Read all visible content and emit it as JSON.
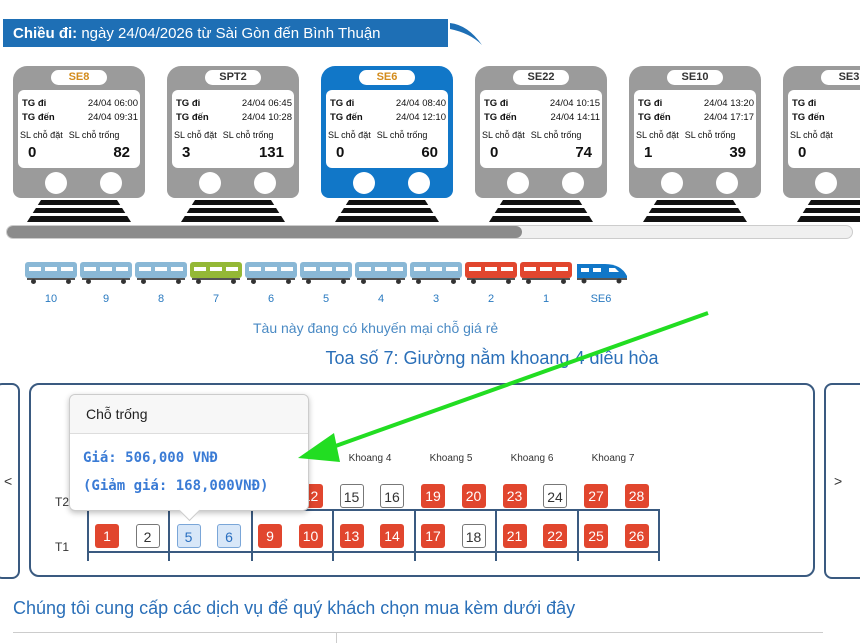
{
  "header": {
    "label": "Chiều đi:",
    "text": "ngày 24/04/2026 từ Sài Gòn đến Bình Thuận"
  },
  "trains": [
    {
      "code": "SE8",
      "code_color": "gold",
      "active": false,
      "tg_di_label": "TG đi",
      "tg_di": "24/04 06:00",
      "tg_den_label": "TG đến",
      "tg_den": "24/04 09:31",
      "booked_label": "SL chỗ đặt",
      "free_label": "SL chỗ trống",
      "booked": "0",
      "free": "82"
    },
    {
      "code": "SPT2",
      "code_color": "dark",
      "active": false,
      "tg_di_label": "TG đi",
      "tg_di": "24/04 06:45",
      "tg_den_label": "TG đến",
      "tg_den": "24/04 10:28",
      "booked_label": "SL chỗ đặt",
      "free_label": "SL chỗ trống",
      "booked": "3",
      "free": "131"
    },
    {
      "code": "SE6",
      "code_color": "gold",
      "active": true,
      "tg_di_label": "TG đi",
      "tg_di": "24/04 08:40",
      "tg_den_label": "TG đến",
      "tg_den": "24/04 12:10",
      "booked_label": "SL chỗ đặt",
      "free_label": "SL chỗ trống",
      "booked": "0",
      "free": "60"
    },
    {
      "code": "SE22",
      "code_color": "dark",
      "active": false,
      "tg_di_label": "TG đi",
      "tg_di": "24/04 10:15",
      "tg_den_label": "TG đến",
      "tg_den": "24/04 14:11",
      "booked_label": "SL chỗ đặt",
      "free_label": "SL chỗ trống",
      "booked": "0",
      "free": "74"
    },
    {
      "code": "SE10",
      "code_color": "dark",
      "active": false,
      "tg_di_label": "TG đi",
      "tg_di": "24/04 13:20",
      "tg_den_label": "TG đến",
      "tg_den": "24/04 17:17",
      "booked_label": "SL chỗ đặt",
      "free_label": "SL chỗ trống",
      "booked": "1",
      "free": "39"
    },
    {
      "code": "SE3",
      "code_color": "dark",
      "active": false,
      "tg_di_label": "TG đi",
      "tg_di": "",
      "tg_den_label": "TG đến",
      "tg_den": "",
      "booked_label": "SL chỗ đặt",
      "free_label": "",
      "booked": "0",
      "free": ""
    }
  ],
  "coaches": [
    {
      "num": "10",
      "color": "#8ab8d6"
    },
    {
      "num": "9",
      "color": "#8ab8d6"
    },
    {
      "num": "8",
      "color": "#8ab8d6"
    },
    {
      "num": "7",
      "color": "#94b836"
    },
    {
      "num": "6",
      "color": "#8ab8d6"
    },
    {
      "num": "5",
      "color": "#8ab8d6"
    },
    {
      "num": "4",
      "color": "#8ab8d6"
    },
    {
      "num": "3",
      "color": "#8ab8d6"
    },
    {
      "num": "2",
      "color": "#e1462e"
    },
    {
      "num": "1",
      "color": "#e1462e"
    }
  ],
  "locomotive": {
    "label": "SE6",
    "color": "#1177c8"
  },
  "promo_text": "Tàu này đang có khuyến mại chỗ giá rẻ",
  "coach_title": "Toa số 7: Giường nằm khoang 4 điều hòa",
  "nav": {
    "prev": "<",
    "next": ">"
  },
  "compartments": [
    "Khoang 4",
    "Khoang 5",
    "Khoang 6",
    "Khoang 7"
  ],
  "tiers": {
    "upper": "T2",
    "lower": "T1"
  },
  "seats_upper": [
    {
      "n": "12",
      "s": "red"
    },
    {
      "n": "15",
      "s": "white"
    },
    {
      "n": "16",
      "s": "white"
    },
    {
      "n": "19",
      "s": "red"
    },
    {
      "n": "20",
      "s": "red"
    },
    {
      "n": "23",
      "s": "red"
    },
    {
      "n": "24",
      "s": "white"
    },
    {
      "n": "27",
      "s": "red"
    },
    {
      "n": "28",
      "s": "red"
    }
  ],
  "seats_lower": [
    {
      "n": "1",
      "s": "red"
    },
    {
      "n": "2",
      "s": "white"
    },
    {
      "n": "5",
      "s": "sel"
    },
    {
      "n": "6",
      "s": "sel"
    },
    {
      "n": "9",
      "s": "red"
    },
    {
      "n": "10",
      "s": "red"
    },
    {
      "n": "13",
      "s": "red"
    },
    {
      "n": "14",
      "s": "red"
    },
    {
      "n": "17",
      "s": "red"
    },
    {
      "n": "18",
      "s": "white"
    },
    {
      "n": "21",
      "s": "red"
    },
    {
      "n": "22",
      "s": "red"
    },
    {
      "n": "25",
      "s": "red"
    },
    {
      "n": "26",
      "s": "red"
    }
  ],
  "tooltip": {
    "title": "Chỗ trống",
    "price": "Giá: 506,000 VNĐ",
    "discount": "(Giảm giá: 168,000VNĐ)"
  },
  "services_text": "Chúng tôi cung cấp các dịch vụ để quý khách chọn mua kèm dưới đây",
  "colors": {
    "primary": "#1e6fb5",
    "active_train": "#1177c8",
    "booked_seat": "#e1462e",
    "arrow": "#22dd22"
  }
}
